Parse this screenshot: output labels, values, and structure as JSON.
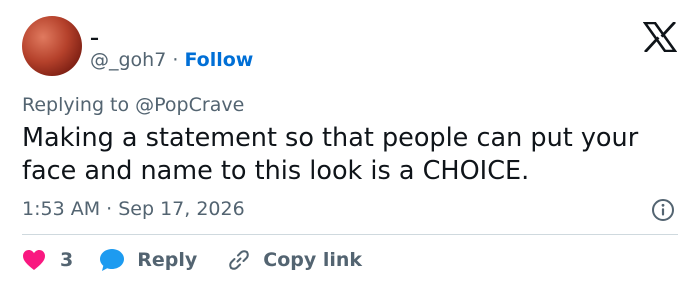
{
  "user": {
    "display_name": "–",
    "handle": "@_goh7",
    "separator": " · ",
    "follow_label": "Follow"
  },
  "tweet": {
    "reply_prefix": "Replying to ",
    "reply_handle": "@PopCrave",
    "text": "Making a statement so that people can put your face and name to this look is a CHOICE.",
    "timestamp": "1:53 AM · Sep 17, 2026"
  },
  "actions": {
    "like_count": "3",
    "reply_label": "Reply",
    "copy_label": "Copy link"
  },
  "icons": {
    "logo": "x-logo-icon",
    "info": "info-icon",
    "like": "heart-icon",
    "reply": "speech-bubble-icon",
    "copy": "link-icon"
  },
  "colors": {
    "follow": "#006fd6",
    "like": "#f91880",
    "reply": "#1d9bf0",
    "secondary_text": "#536471"
  }
}
